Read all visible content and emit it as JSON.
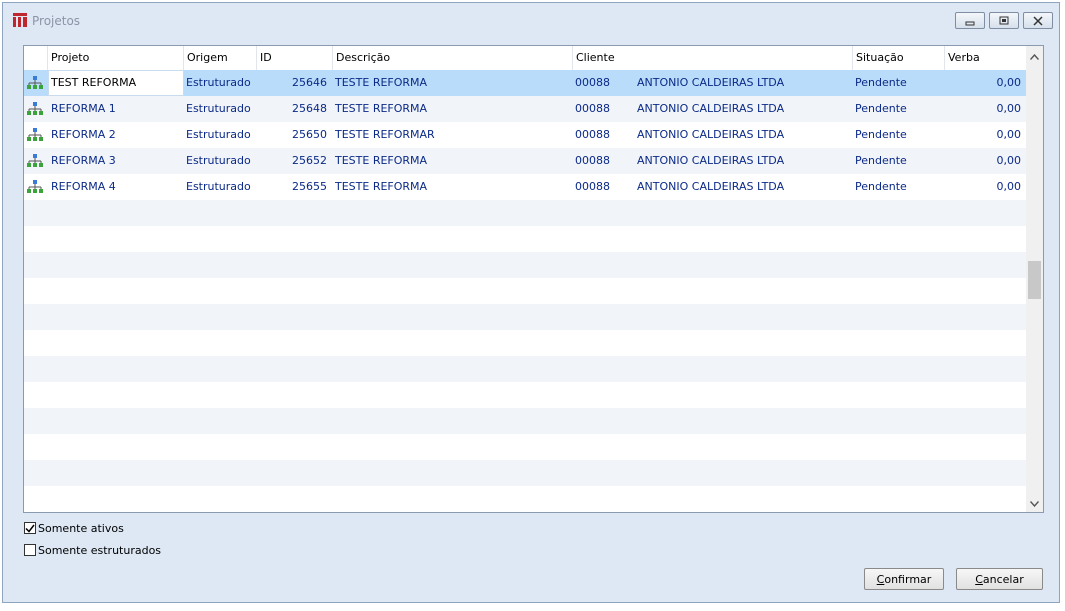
{
  "window": {
    "title": "Projetos"
  },
  "table": {
    "columns": [
      "Projeto",
      "Origem",
      "ID",
      "Descrição",
      "Cliente",
      "Situação",
      "Verba"
    ],
    "rows": [
      {
        "projeto": "TEST REFORMA",
        "origem": "Estruturado",
        "id": "25646",
        "descricao": "TESTE REFORMA",
        "cliente_codigo": "00088",
        "cliente_nome": "ANTONIO CALDEIRAS LTDA",
        "situacao": "Pendente",
        "verba": "0,00",
        "icon": "tree-structure-icon"
      },
      {
        "projeto": "REFORMA 1",
        "origem": "Estruturado",
        "id": "25648",
        "descricao": "TESTE REFORMA",
        "cliente_codigo": "00088",
        "cliente_nome": "ANTONIO CALDEIRAS LTDA",
        "situacao": "Pendente",
        "verba": "0,00",
        "icon": "tree-structure-icon"
      },
      {
        "projeto": "REFORMA 2",
        "origem": "Estruturado",
        "id": "25650",
        "descricao": "TESTE REFORMAR",
        "cliente_codigo": "00088",
        "cliente_nome": "ANTONIO CALDEIRAS LTDA",
        "situacao": "Pendente",
        "verba": "0,00",
        "icon": "tree-structure-icon"
      },
      {
        "projeto": "REFORMA 3",
        "origem": "Estruturado",
        "id": "25652",
        "descricao": "TESTE REFORMA",
        "cliente_codigo": "00088",
        "cliente_nome": "ANTONIO CALDEIRAS LTDA",
        "situacao": "Pendente",
        "verba": "0,00",
        "icon": "tree-structure-icon"
      },
      {
        "projeto": "REFORMA 4",
        "origem": "Estruturado",
        "id": "25655",
        "descricao": "TESTE REFORMA",
        "cliente_codigo": "00088",
        "cliente_nome": "ANTONIO CALDEIRAS LTDA",
        "situacao": "Pendente",
        "verba": "0,00",
        "icon": "tree-structure-icon"
      }
    ],
    "selected_row": 0
  },
  "filters": {
    "somente_ativos": {
      "label": "Somente ativos",
      "checked": true
    },
    "somente_estruturados": {
      "label": "Somente estruturados",
      "checked": false
    }
  },
  "buttons": {
    "confirmar_underlined": "C",
    "confirmar_rest": "onfirmar",
    "cancelar_underlined": "C",
    "cancelar_rest": "ancelar"
  },
  "colors": {
    "accent_text": "#0b2a88",
    "selection": "#b9dcfa",
    "window_bg": "#dde8f4"
  }
}
